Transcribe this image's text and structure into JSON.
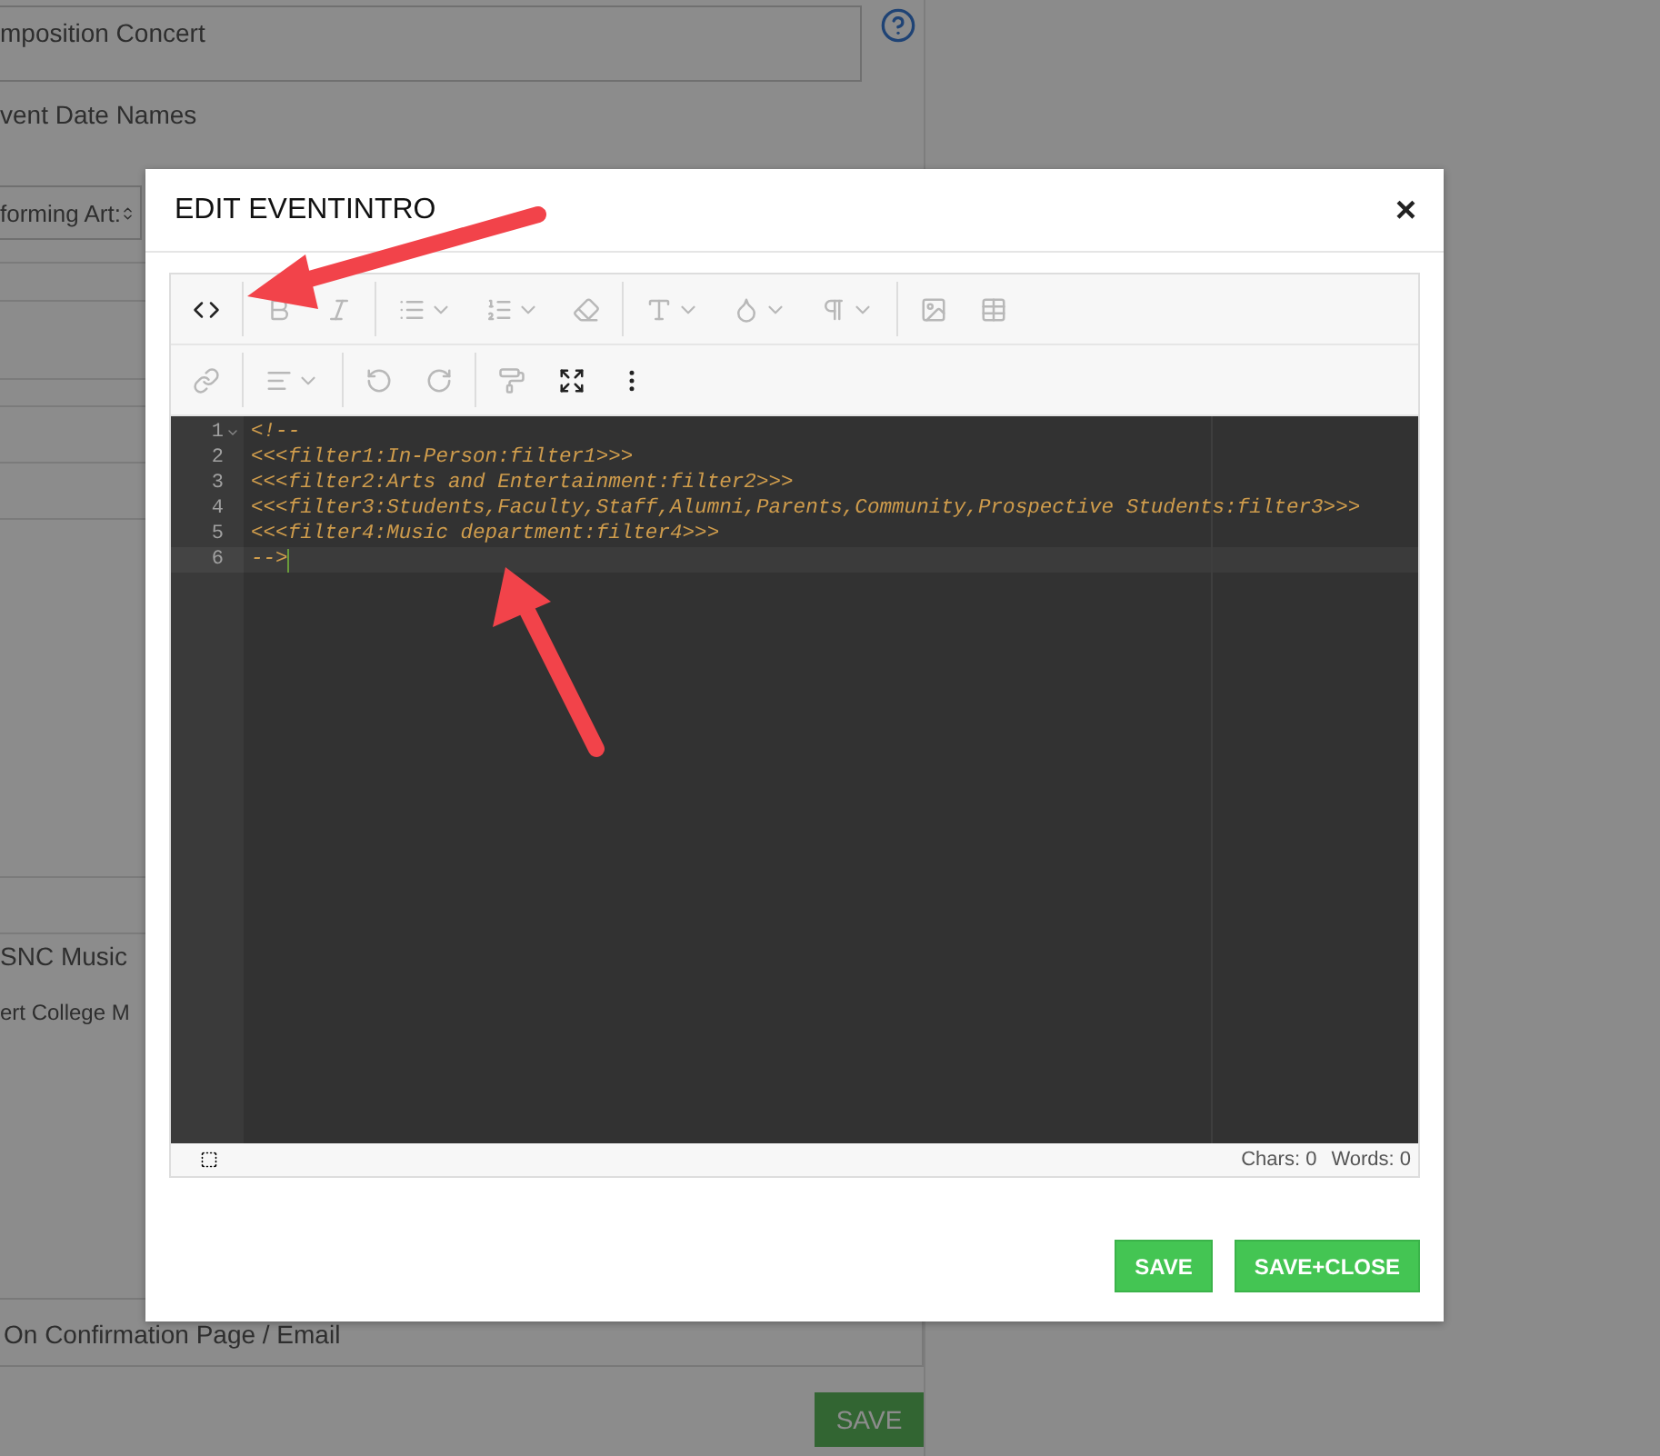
{
  "background_form": {
    "title_field": {
      "value": "mposition Concert"
    },
    "date_names_label": "vent Date Names",
    "category_select": {
      "value": "forming Art:"
    },
    "organizer_text": "SNC Music",
    "organizer_name_text": "ert College M",
    "confirmation_field": {
      "value": "On Confirmation Page / Email"
    },
    "save_button": "SAVE"
  },
  "modal": {
    "title": "EDIT EVENTINTRO",
    "close": "×",
    "toolbar_rows": [
      {
        "groups": [
          {
            "buttons": [
              {
                "kind": "code",
                "dropdown": false,
                "disabled": false
              }
            ]
          },
          {
            "buttons": [
              {
                "kind": "bold",
                "dropdown": false,
                "disabled": true
              },
              {
                "kind": "italic",
                "dropdown": false,
                "disabled": true
              }
            ]
          },
          {
            "buttons": [
              {
                "kind": "bullets",
                "dropdown": true,
                "disabled": true
              },
              {
                "kind": "numbers",
                "dropdown": true,
                "disabled": true
              },
              {
                "kind": "eraser",
                "dropdown": false,
                "disabled": true
              }
            ]
          },
          {
            "buttons": [
              {
                "kind": "fontsize",
                "dropdown": true,
                "disabled": true
              },
              {
                "kind": "color",
                "dropdown": true,
                "disabled": true
              },
              {
                "kind": "paragraph",
                "dropdown": true,
                "disabled": true
              }
            ]
          },
          {
            "buttons": [
              {
                "kind": "image",
                "dropdown": false,
                "disabled": true
              },
              {
                "kind": "table",
                "dropdown": false,
                "disabled": true
              }
            ]
          }
        ]
      },
      {
        "groups": [
          {
            "buttons": [
              {
                "kind": "link",
                "dropdown": false,
                "disabled": true
              }
            ]
          },
          {
            "buttons": [
              {
                "kind": "align",
                "dropdown": true,
                "disabled": true
              }
            ]
          },
          {
            "buttons": [
              {
                "kind": "undo",
                "dropdown": false,
                "disabled": true
              },
              {
                "kind": "redo",
                "dropdown": false,
                "disabled": true
              }
            ]
          },
          {
            "buttons": [
              {
                "kind": "painter",
                "dropdown": false,
                "disabled": true
              },
              {
                "kind": "fullscreen",
                "dropdown": false,
                "disabled": false
              },
              {
                "kind": "more",
                "dropdown": false,
                "disabled": false
              }
            ]
          }
        ]
      }
    ],
    "code_lines": [
      {
        "number": "1",
        "text": "<!--",
        "foldable": true,
        "active": false
      },
      {
        "number": "2",
        "text": "<<<filter1:In-Person:filter1>>>",
        "foldable": false,
        "active": false
      },
      {
        "number": "3",
        "text": "<<<filter2:Arts and Entertainment:filter2>>>",
        "foldable": false,
        "active": false
      },
      {
        "number": "4",
        "text": "<<<filter3:Students,Faculty,Staff,Alumni,Parents,Community,Prospective Students:filter3>>>",
        "foldable": false,
        "active": false
      },
      {
        "number": "5",
        "text": "<<<filter4:Music department:filter4>>>",
        "foldable": false,
        "active": false
      },
      {
        "number": "6",
        "text": "-->",
        "foldable": false,
        "active": true
      }
    ],
    "status": {
      "chars": "Chars: 0",
      "words": "Words: 0"
    },
    "buttons": [
      {
        "label": "SAVE"
      },
      {
        "label": "SAVE+CLOSE"
      }
    ]
  }
}
